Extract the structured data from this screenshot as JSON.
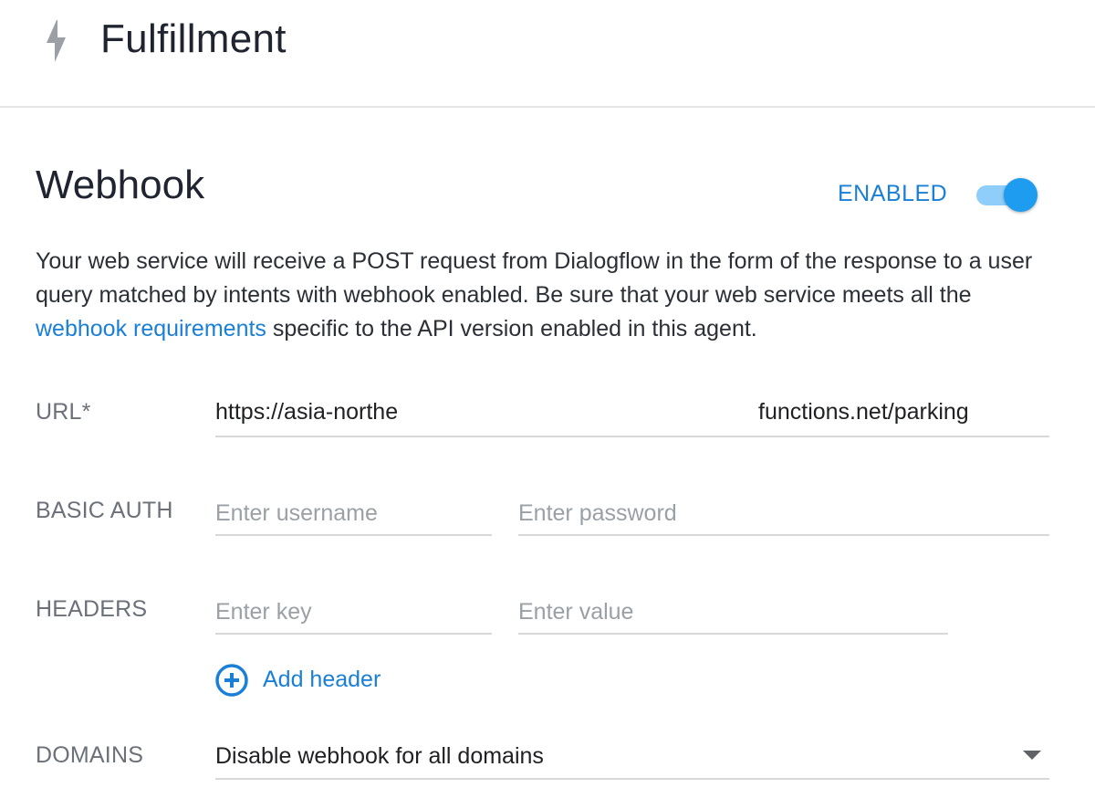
{
  "header": {
    "title": "Fulfillment",
    "icon": "bolt-icon"
  },
  "webhook": {
    "title": "Webhook",
    "status_label": "ENABLED",
    "toggle_on": true,
    "description_part1": "Your web service will receive a POST request from Dialogflow in the form of the response to a user query matched by intents with webhook enabled. Be sure that your web service meets all the ",
    "description_link": "webhook requirements",
    "description_part2": " specific to the API version enabled in this agent."
  },
  "form": {
    "url": {
      "label": "URL*",
      "value_start": "https://asia-northe",
      "value_end": "functions.net/parking"
    },
    "basic_auth": {
      "label": "BASIC AUTH",
      "username_placeholder": "Enter username",
      "password_placeholder": "Enter password"
    },
    "headers": {
      "label": "HEADERS",
      "key_placeholder": "Enter key",
      "value_placeholder": "Enter value",
      "add_label": "Add header"
    },
    "domains": {
      "label": "DOMAINS",
      "selected": "Disable webhook for all domains"
    }
  },
  "colors": {
    "accent": "#1a7fd6",
    "toggle_knob": "#1e9cf0",
    "toggle_track": "#8fcdfb"
  }
}
